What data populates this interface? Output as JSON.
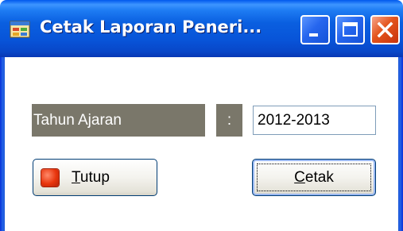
{
  "window": {
    "title": "Cetak Laporan Peneri...",
    "icon": "report-form-icon"
  },
  "title_buttons": {
    "minimize_icon": "minimize-icon",
    "maximize_icon": "maximize-icon",
    "close_icon": "close-icon"
  },
  "form": {
    "label": "Tahun Ajaran",
    "colon": ":",
    "year_value": "2012-2013"
  },
  "buttons": {
    "tutup": {
      "mnemonic": "T",
      "rest": "utup",
      "icon": "stop-icon"
    },
    "cetak": {
      "mnemonic": "C",
      "rest": "etak"
    }
  },
  "colors": {
    "titlebar": "#0a5fe0",
    "label_bg": "#7a776a",
    "close_button": "#e3541c",
    "stop_icon": "#e8350d"
  }
}
